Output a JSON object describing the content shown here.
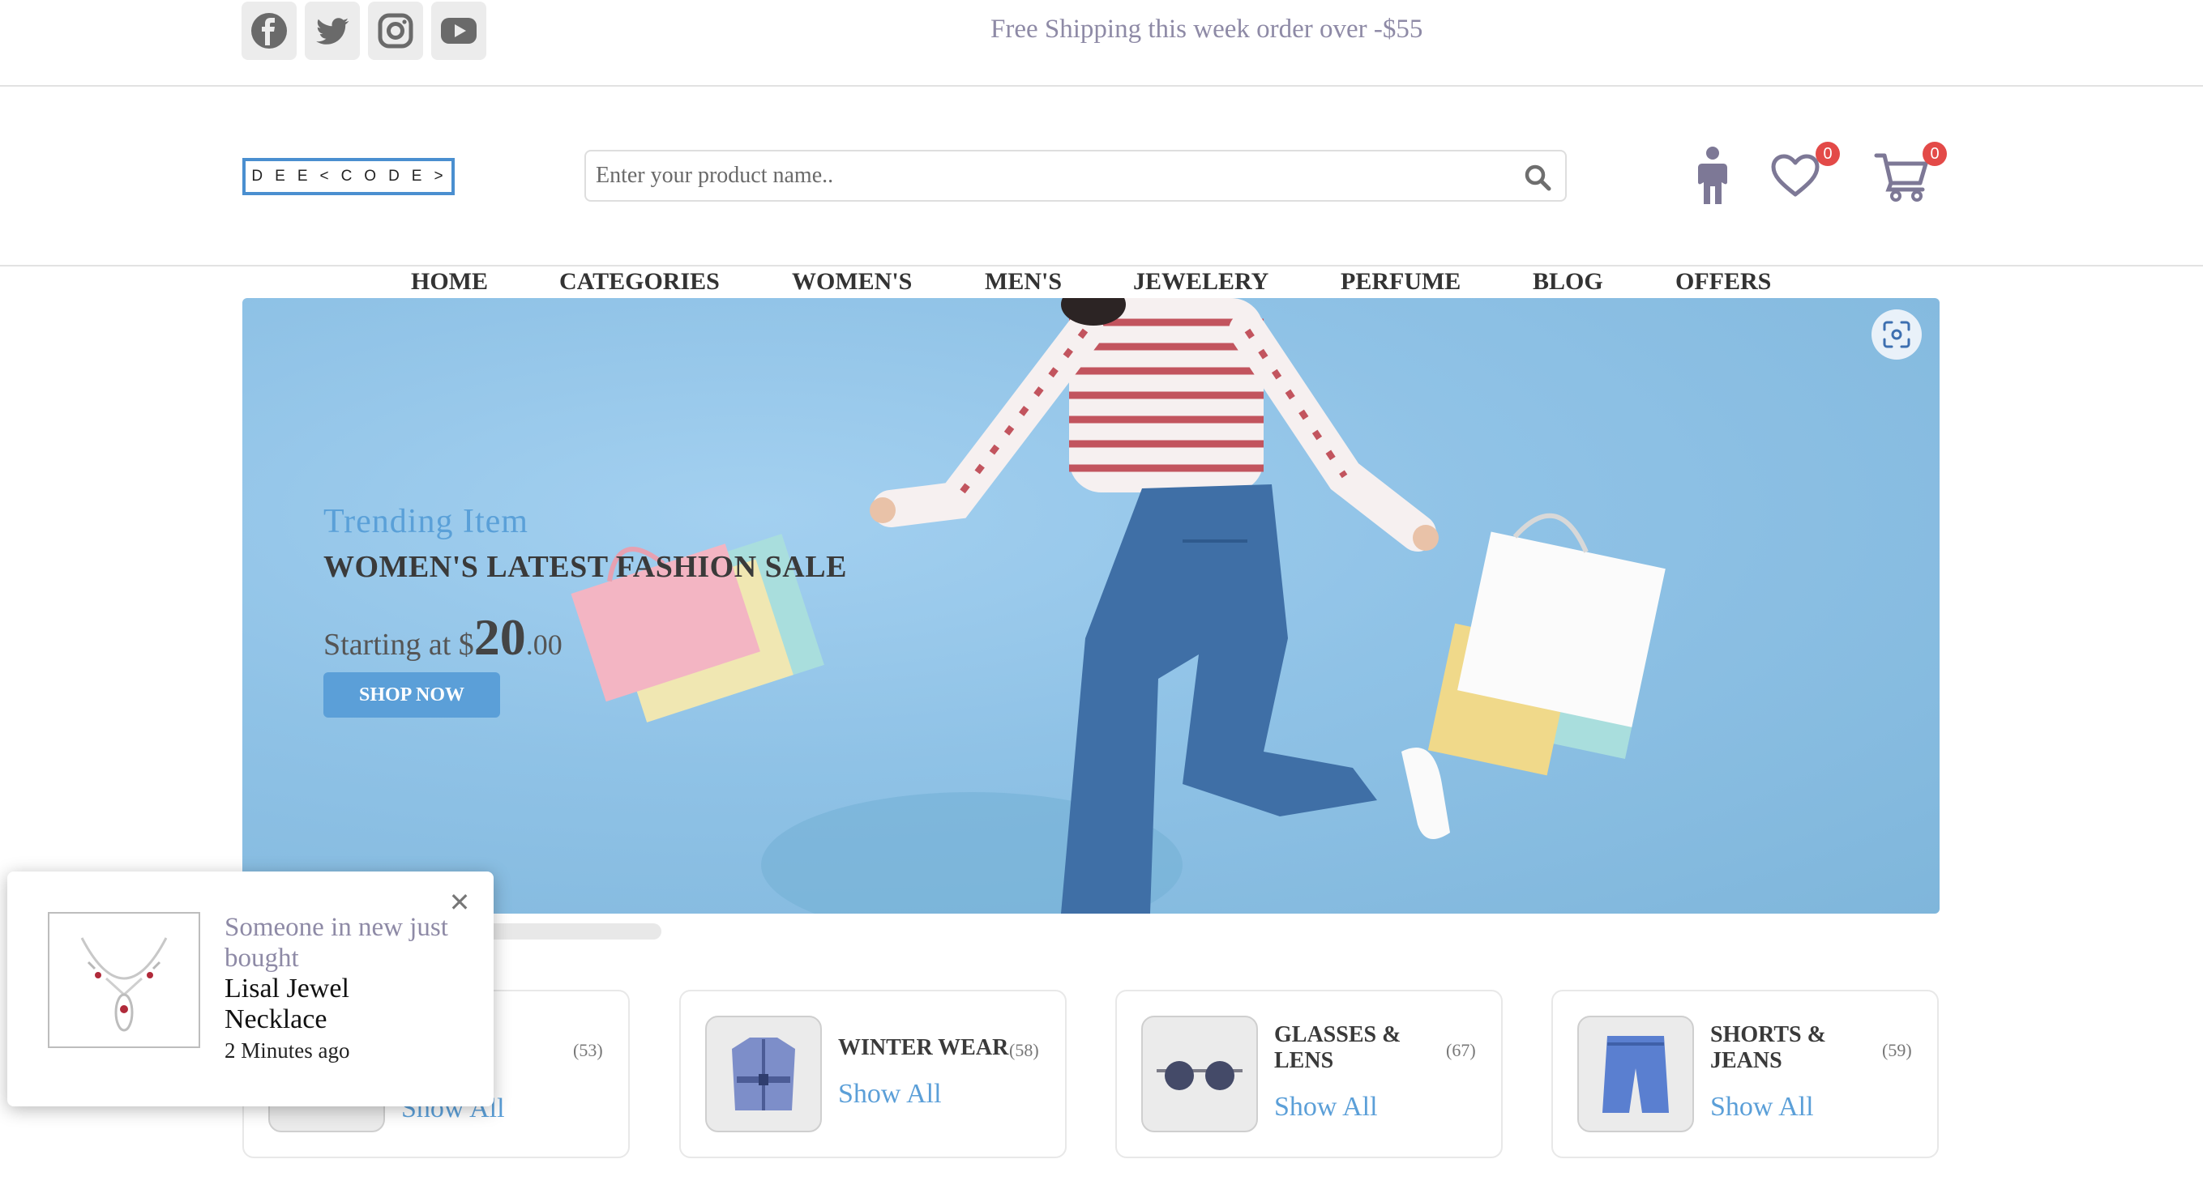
{
  "topbar": {
    "socials": [
      {
        "icon": "facebook-icon"
      },
      {
        "icon": "twitter-icon"
      },
      {
        "icon": "instagram-icon"
      },
      {
        "icon": "youtube-icon"
      }
    ],
    "promo_text": "Free Shipping this week order over -$55"
  },
  "header": {
    "logo_text": "DEE<CODE>",
    "search": {
      "placeholder": "Enter your product name.."
    },
    "wishlist_count": "0",
    "cart_count": "0"
  },
  "nav": {
    "items": [
      "HOME",
      "CATEGORIES",
      "WOMEN'S",
      "MEN'S",
      "JEWELERY",
      "PERFUME",
      "BLOG",
      "OFFERS"
    ]
  },
  "hero": {
    "subtitle": "Trending Item",
    "title": "WOMEN'S LATEST FASHION SALE",
    "price_prefix": "Starting at $",
    "price_whole": "20",
    "price_cents": ".00",
    "button_label": "SHOP NOW"
  },
  "categories": [
    {
      "name": "",
      "count": "(53)",
      "link": "Show All"
    },
    {
      "name": "WINTER WEAR",
      "count": "(58)",
      "link": "Show All"
    },
    {
      "name": "GLASSES & LENS",
      "count": "(67)",
      "link": "Show All"
    },
    {
      "name": "SHORTS & JEANS",
      "count": "(59)",
      "link": "Show All"
    }
  ],
  "toast": {
    "line1": "Someone in new just bought",
    "product": "Lisal Jewel Necklace",
    "time": "2 Minutes ago"
  },
  "colors": {
    "accent": "#5b9fd8",
    "badge": "#e34a48",
    "muted_text": "#8e8aa6",
    "hero_bg": "#8fc2e6"
  }
}
